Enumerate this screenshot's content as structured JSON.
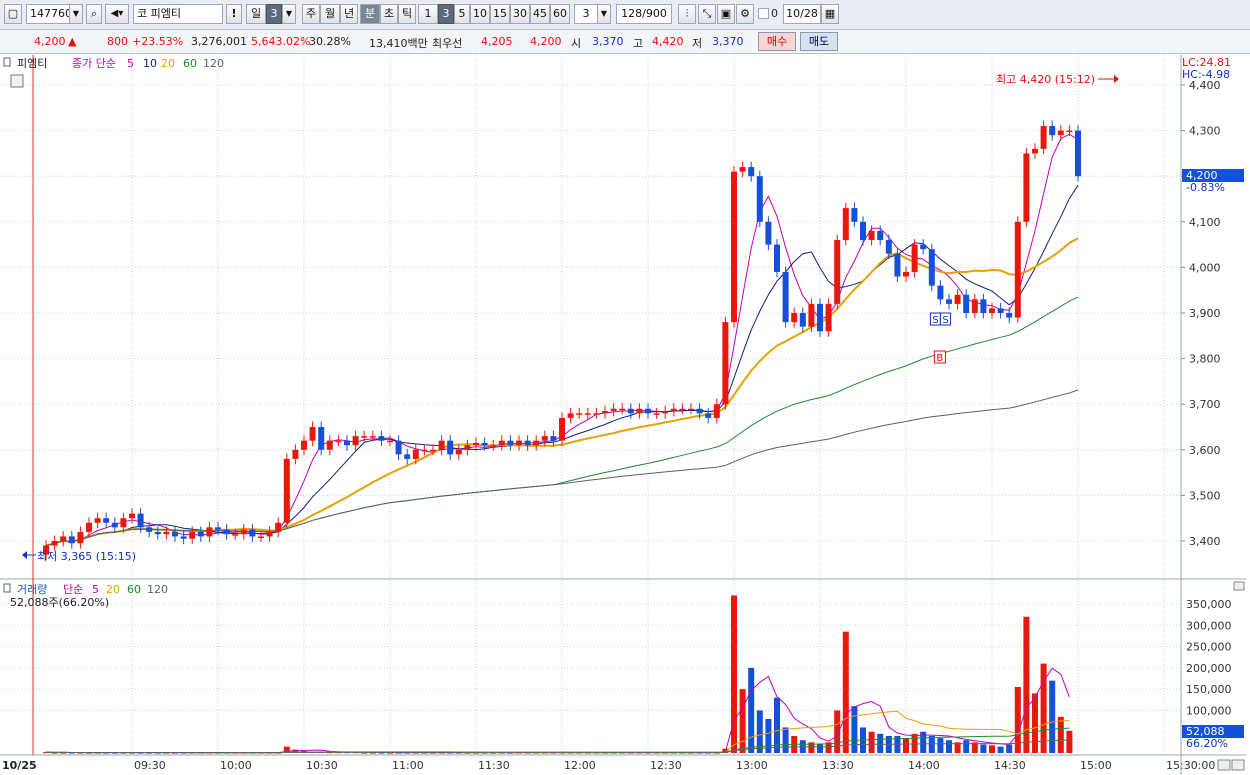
{
  "toolbar": {
    "code": "147760",
    "market_label": "코",
    "stock_name": "피엠티",
    "exclaim": "!",
    "period_day": "일",
    "period_num": "3",
    "period_week": "주",
    "period_month": "월",
    "period_year": "년",
    "period_min": "분",
    "period_sec": "초",
    "period_tick": "틱",
    "intervals": [
      "1",
      "3",
      "5",
      "10",
      "15",
      "30",
      "45",
      "60"
    ],
    "interval_value": "3",
    "count": "128/900",
    "check_value": "0",
    "date": "10/28"
  },
  "quote": {
    "price": "4,200",
    "arrow": "▲",
    "change": "800",
    "change_pct": "+23.53%",
    "volume": "3,276,001",
    "vol_ratio": "5,643.02%",
    "turnover": "30.28%",
    "amount": "13,410백만",
    "best_ask_label": "최우선",
    "best_ask": "4,205",
    "best_bid": "4,200",
    "open_label": "시",
    "open": "3,370",
    "high_label": "고",
    "high": "4,420",
    "low_label": "저",
    "low": "3,370",
    "buy_label": "매수",
    "sell_label": "매도"
  },
  "price_panel": {
    "title": "피엠티",
    "legend_prefix": "종가 단순",
    "ma_periods": [
      "5",
      "10",
      "20",
      "60",
      "120"
    ],
    "lc": "LC:24.81",
    "hc": "HC:-4.98",
    "high_annot": "최고 4,420 (15:12)",
    "low_annot": "최저 3,365 (15:15)",
    "current_price": "4,200",
    "current_pct": "-0.83%",
    "y_ticks": [
      "4,400",
      "4,300",
      "4,200",
      "4,100",
      "4,000",
      "3,900",
      "3,800",
      "3,700",
      "3,600",
      "3,500",
      "3,400"
    ],
    "marker_s": "S",
    "marker_b": "B"
  },
  "volume_panel": {
    "title": "거래량",
    "legend_prefix": "단순",
    "ma_periods": [
      "5",
      "20",
      "60",
      "120"
    ],
    "value_text": "52,088주(66.20%)",
    "current": "52,088",
    "current_pct": "66.20%",
    "y_ticks": [
      "350,000",
      "300,000",
      "250,000",
      "200,000",
      "150,000",
      "100,000"
    ]
  },
  "x_axis": {
    "date": "10/25",
    "ticks": [
      "09:30",
      "10:00",
      "10:30",
      "11:00",
      "11:30",
      "12:00",
      "12:30",
      "13:00",
      "13:30",
      "14:00",
      "14:30",
      "15:00",
      "15:30:00"
    ]
  },
  "colors": {
    "up": "#e8180c",
    "down": "#1450d8",
    "ma5": "#c000c0",
    "ma10": "#102080",
    "ma20": "#e8a000",
    "ma60": "#1a8a30",
    "ma120": "#606060"
  },
  "chart_data": [
    {
      "type": "candlestick",
      "x_unit": "3-minute bars, 10/25",
      "x_start": "09:00",
      "ylim": [
        3365,
        4420
      ],
      "series": [
        {
          "name": "close",
          "values": [
            3390,
            3400,
            3410,
            3395,
            3420,
            3440,
            3450,
            3440,
            3430,
            3450,
            3460,
            3430,
            3420,
            3415,
            3420,
            3410,
            3405,
            3420,
            3410,
            3430,
            3425,
            3415,
            3415,
            3425,
            3410,
            3410,
            3420,
            3440,
            3580,
            3600,
            3620,
            3650,
            3600,
            3620,
            3620,
            3610,
            3630,
            3630,
            3630,
            3620,
            3620,
            3590,
            3580,
            3600,
            3600,
            3600,
            3620,
            3590,
            3600,
            3610,
            3615,
            3610,
            3610,
            3620,
            3610,
            3620,
            3610,
            3620,
            3630,
            3620,
            3670,
            3680,
            3680,
            3680,
            3680,
            3685,
            3690,
            3690,
            3680,
            3690,
            3680,
            3680,
            3685,
            3690,
            3690,
            3690,
            3680,
            3670,
            3700,
            3880,
            4210,
            4220,
            4200,
            4100,
            4050,
            3990,
            3880,
            3900,
            3870,
            3920,
            3860,
            3920,
            4060,
            4130,
            4100,
            4060,
            4080,
            4060,
            4030,
            3980,
            3990,
            4050,
            4040,
            3960,
            3930,
            3920,
            3940,
            3900,
            3930,
            3900,
            3910,
            3900,
            3890,
            4100,
            4250,
            4260,
            4310,
            4290,
            4300,
            4300,
            4200
          ]
        }
      ],
      "moving_averages": [
        "5",
        "10",
        "20",
        "60",
        "120"
      ],
      "annotations": [
        "최고 4,420 (15:12)",
        "최저 3,365 (15:15)"
      ]
    },
    {
      "type": "bar",
      "title": "거래량",
      "ylim": [
        0,
        380000
      ],
      "series": [
        {
          "name": "volume",
          "values": [
            2000,
            1000,
            1000,
            1000,
            1000,
            1000,
            1000,
            1000,
            1000,
            1000,
            1000,
            1000,
            1000,
            1000,
            1000,
            1000,
            1000,
            1000,
            1000,
            1000,
            1000,
            1000,
            1000,
            1000,
            1000,
            1000,
            1000,
            1000,
            15000,
            8000,
            5000,
            3000,
            3000,
            2000,
            2000,
            2000,
            2000,
            1000,
            1000,
            1000,
            1000,
            1000,
            1000,
            1000,
            1000,
            1000,
            1000,
            1000,
            1000,
            1000,
            1000,
            1000,
            1000,
            1000,
            1000,
            1000,
            1000,
            1000,
            1000,
            1000,
            1000,
            1000,
            1000,
            1000,
            1000,
            1000,
            1000,
            1000,
            1000,
            1000,
            1000,
            1000,
            1000,
            1000,
            1000,
            1000,
            1000,
            1000,
            1000,
            10000,
            370000,
            150000,
            200000,
            100000,
            80000,
            130000,
            60000,
            40000,
            30000,
            25000,
            20000,
            25000,
            100000,
            285000,
            110000,
            60000,
            50000,
            45000,
            40000,
            40000,
            35000,
            45000,
            50000,
            40000,
            35000,
            30000,
            25000,
            30000,
            25000,
            20000,
            18000,
            15000,
            20000,
            155000,
            320000,
            140000,
            210000,
            170000,
            85000,
            52088
          ]
        }
      ]
    }
  ]
}
